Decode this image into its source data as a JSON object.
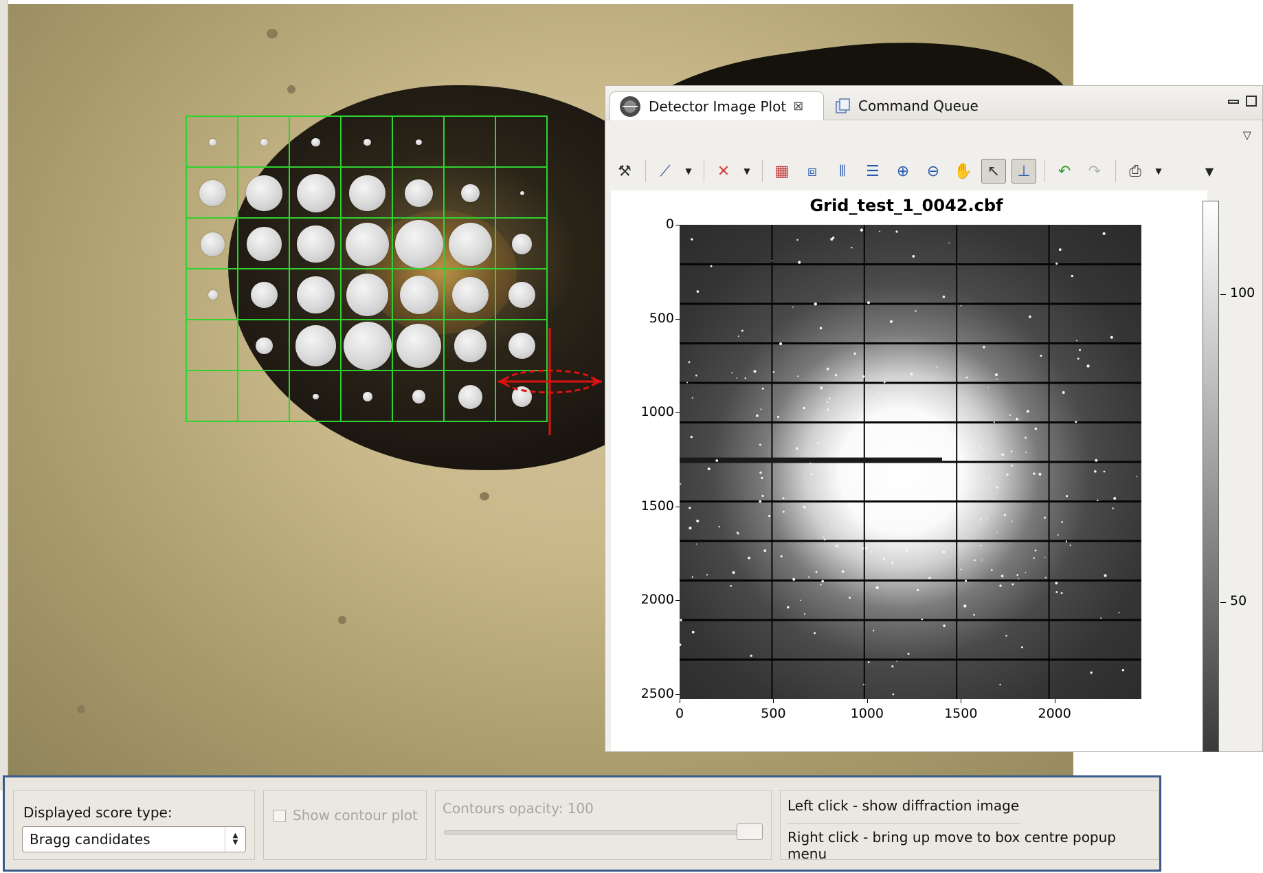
{
  "detector_window": {
    "tabs": [
      {
        "label": "Detector Image Plot",
        "active": true
      },
      {
        "label": "Command Queue",
        "active": false
      }
    ],
    "toolbar_icons": [
      "tools-icon",
      "axis-icon",
      "scatter-icon",
      "histogram-icon",
      "zoom-box-icon",
      "vertical-cut-icon",
      "horizontal-cut-icon",
      "zoom-in-icon",
      "zoom-out-icon",
      "pan-hand-icon",
      "select-arrow-icon",
      "axes-origin-icon",
      "undo-icon",
      "redo-icon",
      "print-icon"
    ]
  },
  "plot": {
    "title": "Grid_test_1_0042.cbf",
    "y_ticks": [
      "0",
      "500",
      "1000",
      "1500",
      "2000",
      "2500"
    ],
    "x_ticks": [
      "0",
      "500",
      "1000",
      "1500",
      "2000"
    ],
    "colorbar_ticks": [
      "100",
      "50"
    ]
  },
  "chart_data": {
    "type": "heatmap",
    "title": "Grid_test_1_0042.cbf",
    "xlim": [
      0,
      2463
    ],
    "ylim": [
      0,
      2527
    ],
    "x_ticks": [
      0,
      500,
      1000,
      1500,
      2000
    ],
    "y_ticks": [
      0,
      500,
      1000,
      1500,
      2000,
      2500
    ],
    "y_axis_inverted": true,
    "colorbar": {
      "ticks": [
        100,
        50
      ],
      "colormap": "grayscale"
    },
    "grid": true
  },
  "scan_grid": {
    "rows": 6,
    "cols": 7,
    "cell_color": "#2fd22f",
    "scores": [
      [
        0.15,
        0.15,
        0.18,
        0.15,
        0.12,
        0.0,
        0.0
      ],
      [
        0.55,
        0.75,
        0.8,
        0.75,
        0.58,
        0.38,
        0.05
      ],
      [
        0.5,
        0.72,
        0.78,
        0.9,
        1.0,
        0.9,
        0.42
      ],
      [
        0.2,
        0.55,
        0.78,
        0.88,
        0.8,
        0.75,
        0.55
      ],
      [
        0.0,
        0.35,
        0.85,
        1.0,
        0.92,
        0.68,
        0.55
      ],
      [
        0.0,
        0.0,
        0.12,
        0.2,
        0.28,
        0.5,
        0.42
      ]
    ]
  },
  "controls": {
    "score_type_label": "Displayed score type:",
    "score_type_value": "Bragg candidates",
    "contour_label": "Show contour plot",
    "contour_checked": false,
    "opacity_label": "Contours opacity: 100",
    "opacity_value": 100,
    "hint_left": "Left click - show diffraction image",
    "hint_right": "Right click - bring up move to box centre popup menu"
  }
}
